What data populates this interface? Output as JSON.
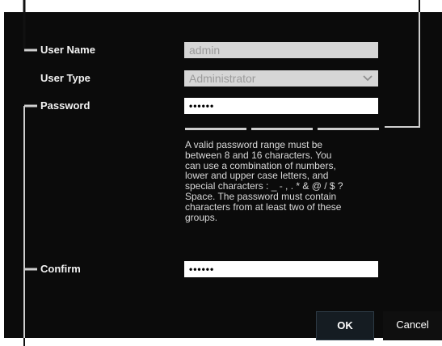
{
  "form": {
    "user_name_label": "User Name",
    "user_name_value": "admin",
    "user_type_label": "User Type",
    "user_type_value": "Administrator",
    "password_label": "Password",
    "password_value": "••••••",
    "confirm_label": "Confirm",
    "confirm_value": "••••••",
    "help_text": "A valid password range must be\nbetween 8 and 16 characters. You\ncan use a combination of numbers,\nlower and upper case letters, and\nspecial characters : _ - , . * & @ / $ ?\nSpace. The password must contain\ncharacters from at least two of these\ngroups.",
    "strength_segments": 3
  },
  "buttons": {
    "ok_label": "OK",
    "cancel_label": "Cancel"
  },
  "colors": {
    "panel_bg": "#0b0b0b",
    "disabled_field": "#d6d6d6",
    "ok_border": "#2d3a45"
  },
  "icons": {
    "dropdown": "chevron-down-icon"
  }
}
